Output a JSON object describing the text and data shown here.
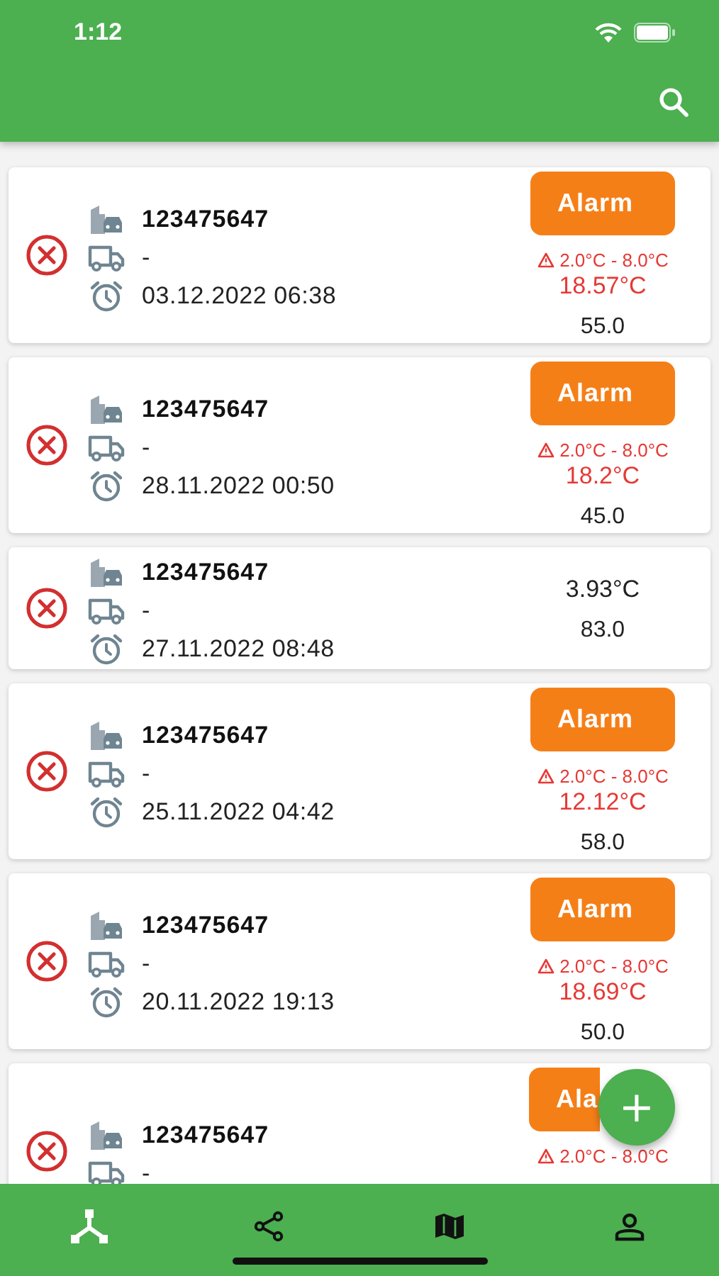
{
  "status_bar": {
    "time": "1:12"
  },
  "records": [
    {
      "failed": true,
      "id": "123475647",
      "vehicle": "-",
      "date": "03.12.2022 06:38",
      "alarm": true,
      "alarm_label": "Alarm",
      "range": "2.0°C - 8.0°C",
      "temperature": "18.57°C",
      "value": "55.0"
    },
    {
      "failed": true,
      "id": "123475647",
      "vehicle": "-",
      "date": "28.11.2022 00:50",
      "alarm": true,
      "alarm_label": "Alarm",
      "range": "2.0°C - 8.0°C",
      "temperature": "18.2°C",
      "value": "45.0"
    },
    {
      "failed": true,
      "id": "123475647",
      "vehicle": "-",
      "date": "27.11.2022 08:48",
      "alarm": false,
      "temperature": "3.93°C",
      "value": "83.0"
    },
    {
      "failed": true,
      "id": "123475647",
      "vehicle": "-",
      "date": "25.11.2022 04:42",
      "alarm": true,
      "alarm_label": "Alarm",
      "range": "2.0°C - 8.0°C",
      "temperature": "12.12°C",
      "value": "58.0"
    },
    {
      "failed": true,
      "id": "123475647",
      "vehicle": "-",
      "date": "20.11.2022 19:13",
      "alarm": true,
      "alarm_label": "Alarm",
      "range": "2.0°C - 8.0°C",
      "temperature": "18.69°C",
      "value": "50.0"
    },
    {
      "failed": true,
      "id": "123475647",
      "vehicle": "-",
      "alarm": true,
      "covered": true,
      "alarm_label": "Ala",
      "range": "2.0°C - 8.0°C"
    }
  ],
  "fab": {
    "label": "+"
  },
  "bottom_nav": [
    {
      "kind": "network",
      "selected": true
    },
    {
      "kind": "share",
      "selected": false
    },
    {
      "kind": "map",
      "selected": false
    },
    {
      "kind": "person",
      "selected": false
    }
  ]
}
